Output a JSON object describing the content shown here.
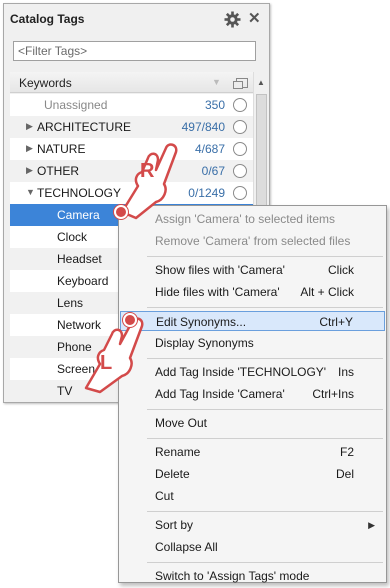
{
  "panel": {
    "title": "Catalog Tags",
    "filter_placeholder": "<Filter Tags>",
    "header_label": "Keywords"
  },
  "tags": [
    {
      "label": "Unassigned",
      "count": "350",
      "expand": "",
      "indent": 1,
      "dim": true
    },
    {
      "label": "ARCHITECTURE",
      "count": "497/840",
      "expand": "collapsed",
      "indent": 0
    },
    {
      "label": "NATURE",
      "count": "4/687",
      "expand": "collapsed",
      "indent": 0
    },
    {
      "label": "OTHER",
      "count": "0/67",
      "expand": "collapsed",
      "indent": 0
    },
    {
      "label": "TECHNOLOGY",
      "count": "0/1249",
      "expand": "expanded",
      "indent": 0
    },
    {
      "label": "Camera",
      "count": "",
      "expand": "",
      "indent": 2,
      "selected": true
    },
    {
      "label": "Clock",
      "count": "",
      "expand": "",
      "indent": 2
    },
    {
      "label": "Headset",
      "count": "",
      "expand": "",
      "indent": 2
    },
    {
      "label": "Keyboard",
      "count": "",
      "expand": "",
      "indent": 2
    },
    {
      "label": "Lens",
      "count": "",
      "expand": "",
      "indent": 2
    },
    {
      "label": "Network",
      "count": "",
      "expand": "",
      "indent": 2
    },
    {
      "label": "Phone",
      "count": "",
      "expand": "",
      "indent": 2
    },
    {
      "label": "Screen",
      "count": "",
      "expand": "",
      "indent": 2
    },
    {
      "label": "TV",
      "count": "",
      "expand": "",
      "indent": 2
    }
  ],
  "menu": {
    "items": [
      {
        "label": "Assign 'Camera' to selected items",
        "shortcut": "",
        "disabled": true
      },
      {
        "label": "Remove 'Camera' from selected files",
        "shortcut": "",
        "disabled": true
      },
      {
        "sep": true
      },
      {
        "label": "Show files with 'Camera'",
        "shortcut": "Click"
      },
      {
        "label": "Hide files with 'Camera'",
        "shortcut": "Alt + Click"
      },
      {
        "sep": true
      },
      {
        "label": "Edit Synonyms...",
        "shortcut": "Ctrl+Y",
        "highlighted": true
      },
      {
        "label": "Display Synonyms",
        "shortcut": ""
      },
      {
        "sep": true
      },
      {
        "label": "Add Tag Inside 'TECHNOLOGY'",
        "shortcut": "Ins"
      },
      {
        "label": "Add Tag Inside 'Camera'",
        "shortcut": "Ctrl+Ins"
      },
      {
        "sep": true
      },
      {
        "label": "Move Out",
        "shortcut": ""
      },
      {
        "sep": true
      },
      {
        "label": "Rename",
        "shortcut": "F2"
      },
      {
        "label": "Delete",
        "shortcut": "Del"
      },
      {
        "label": "Cut",
        "shortcut": ""
      },
      {
        "sep": true
      },
      {
        "label": "Sort by",
        "shortcut": "",
        "submenu": true
      },
      {
        "label": "Collapse All",
        "shortcut": ""
      },
      {
        "sep": true
      },
      {
        "label": "Switch to 'Assign Tags' mode",
        "shortcut": ""
      }
    ]
  },
  "callouts": {
    "right_click": "R",
    "left_click": "L"
  },
  "icons": {
    "gear": "gear-icon",
    "close": "close-icon",
    "expand_collapsed": "triangle-right-icon",
    "expand_expanded": "triangle-down-icon",
    "submenu": "submenu-arrow-icon"
  },
  "colors": {
    "selection": "#3c84d8",
    "menu_highlight": "#d9e8fb",
    "callout": "#d34a4a",
    "count_text": "#3a6fa8"
  }
}
